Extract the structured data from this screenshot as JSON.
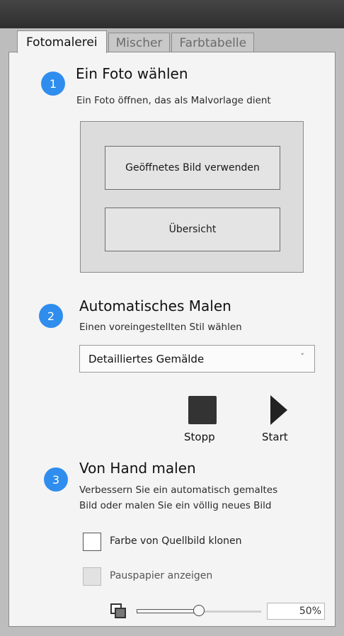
{
  "tabs": [
    {
      "label": "Fotomalerei",
      "active": true
    },
    {
      "label": "Mischer",
      "active": false
    },
    {
      "label": "Farbtabelle",
      "active": false
    }
  ],
  "step1": {
    "number": "1",
    "title": "Ein Foto wählen",
    "subtitle": "Ein Foto öffnen, das als Malvorlage dient",
    "use_open_image_label": "Geöffnetes Bild verwenden",
    "browse_label": "Übersicht"
  },
  "step2": {
    "number": "2",
    "title": "Automatisches Malen",
    "subtitle": "Einen voreingestellten Stil wählen",
    "style_selected": "Detailliertes Gemälde",
    "stop_label": "Stopp",
    "start_label": "Start"
  },
  "step3": {
    "number": "3",
    "title": "Von Hand malen",
    "subtitle_line1": "Verbessern Sie ein automatisch gemaltes",
    "subtitle_line2": "Bild oder malen Sie ein völlig neues Bild",
    "clone_color_label": "Farbe von Quellbild klonen",
    "clone_color_checked": false,
    "tracing_paper_label": "Pauspapier anzeigen",
    "tracing_paper_checked": false,
    "tracing_paper_enabled": false,
    "opacity_slider_fraction": 0.5,
    "opacity_value": "50%"
  },
  "icons": {
    "stop": "stop-square",
    "start": "play-triangle",
    "layers": "overlapping-squares",
    "dropdown": "chevron-down"
  },
  "colors": {
    "step_circle": "#2f8ded",
    "panel_background": "#f4f4f4",
    "group_background": "#dcdcdc"
  }
}
